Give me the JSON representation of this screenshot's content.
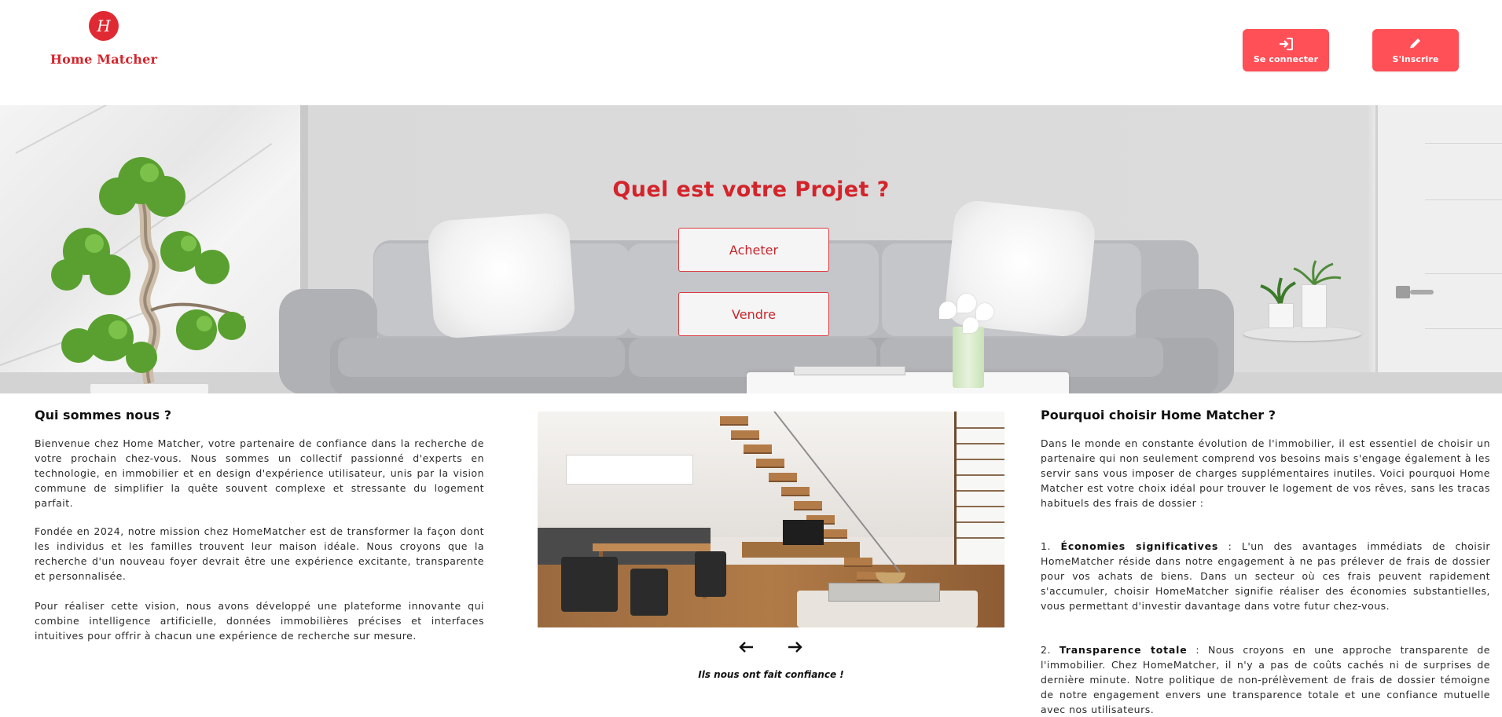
{
  "brand": {
    "name": "Home Matcher",
    "logo_letter": "H",
    "color": "#d4242b"
  },
  "header": {
    "login_label": "Se connecter",
    "signup_label": "S'inscrire",
    "login_icon": "sign-in-icon",
    "signup_icon": "pencil-icon",
    "button_color": "#ff4f57"
  },
  "hero": {
    "title": "Quel est votre Projet ?",
    "buy_label": "Acheter",
    "sell_label": "Vendre"
  },
  "about": {
    "title": "Qui sommes nous ?",
    "paragraphs": [
      "Bienvenue chez Home Matcher, votre partenaire de confiance dans la recherche de votre prochain chez-vous. Nous sommes un collectif passionné d'experts en technologie, en immobilier et en design d'expérience utilisateur, unis par la vision commune de simplifier la quête souvent complexe et stressante du logement parfait.",
      "Fondée en 2024, notre mission chez HomeMatcher est de transformer la façon dont les individus et les familles trouvent leur maison idéale. Nous croyons que la recherche d'un nouveau foyer devrait être une expérience excitante, transparente et personnalisée.",
      "Pour réaliser cette vision, nous avons développé une plateforme innovante qui combine intelligence artificielle, données immobilières précises et interfaces intuitives pour offrir à chacun une expérience de recherche sur mesure."
    ]
  },
  "carousel": {
    "prev_icon": "arrow-left-icon",
    "next_icon": "arrow-right-icon",
    "caption": "Ils nous ont fait confiance !"
  },
  "why": {
    "title": "Pourquoi choisir Home Matcher ?",
    "intro": "Dans le monde en constante évolution de l'immobilier, il est essentiel de choisir un partenaire qui non seulement comprend vos besoins mais s'engage également à les servir sans vous imposer de charges supplémentaires inutiles. Voici pourquoi Home Matcher est votre choix idéal pour trouver le logement de vos rêves, sans les tracas habituels des frais de dossier :",
    "points": [
      {
        "number": "1.",
        "heading": "Économies significatives",
        "text": " : L'un des avantages immédiats de choisir HomeMatcher réside dans notre engagement à ne pas prélever de frais de dossier pour vos achats de biens. Dans un secteur où ces frais peuvent rapidement s'accumuler, choisir HomeMatcher signifie réaliser des économies substantielles, vous permettant d'investir davantage dans votre futur chez-vous."
      },
      {
        "number": "2.",
        "heading": "Transparence totale",
        "text": " : Nous croyons en une approche transparente de l'immobilier. Chez HomeMatcher, il n'y a pas de coûts cachés ni de surprises de dernière minute. Notre politique de non-prélèvement de frais de dossier témoigne de notre engagement envers une transparence totale et une confiance mutuelle avec nos utilisateurs."
      }
    ]
  }
}
